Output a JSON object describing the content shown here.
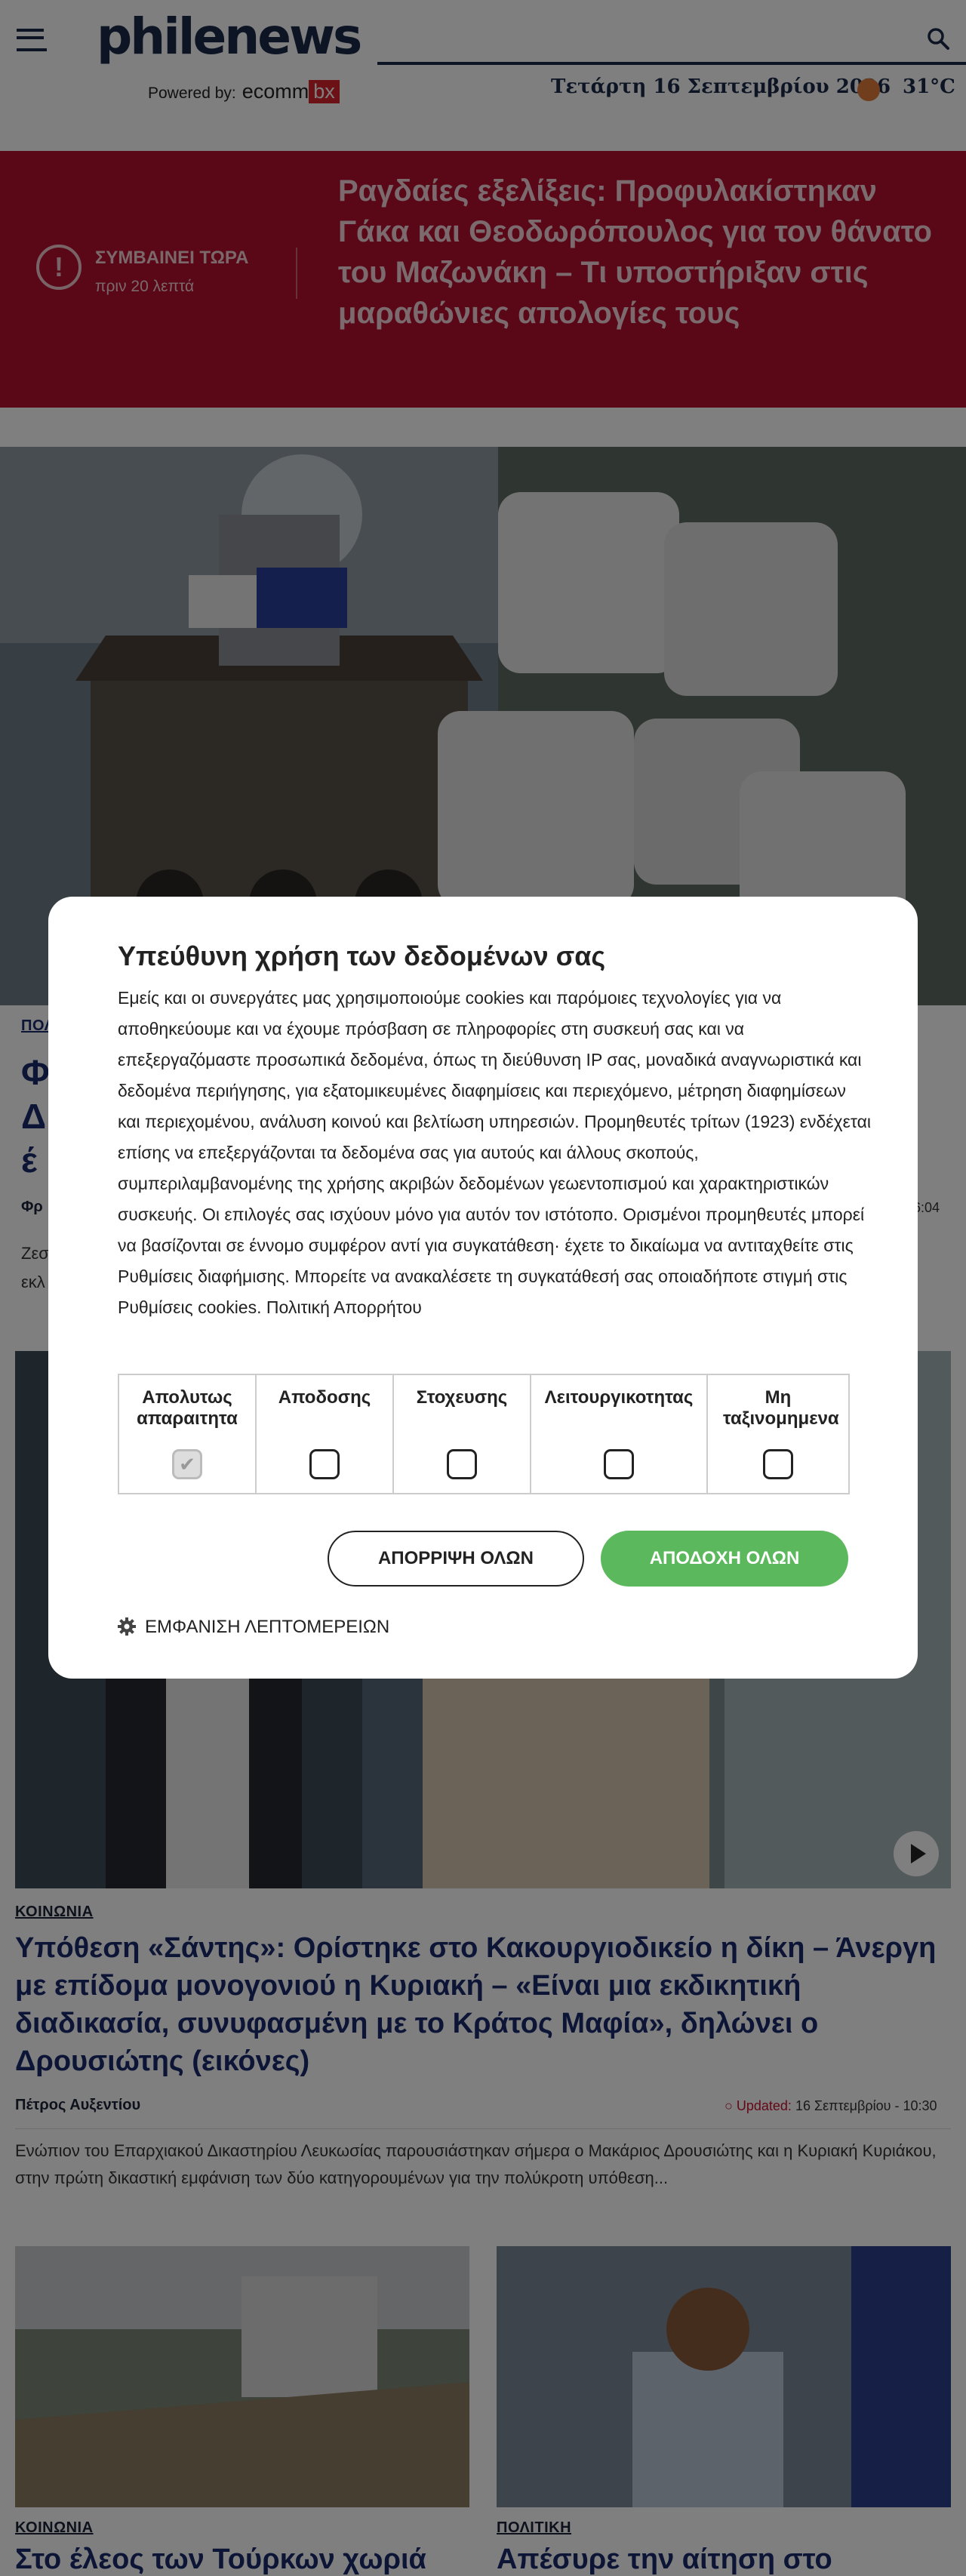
{
  "header": {
    "logo": "philenews",
    "powered_by": "Powered by:",
    "powered_brand_a": "ecomm",
    "powered_brand_b": "bx",
    "date": "Τετάρτη 16 Σεπτεμβρίου 2026",
    "temperature": "31°C"
  },
  "breaking": {
    "label": "ΣΥΜΒΑΙΝΕΙ ΤΩΡΑ",
    "time": "πριν 20 λεπτά",
    "title": "Ραγδαίες εξελίξεις: Προφυλακίστηκαν Γάκα και Θεοδωρόπουλος για τον θάνατο του Μαζωνάκη – Τι υποστήριξαν στις μαραθώνιες απολογίες τους"
  },
  "lead": {
    "cat_fragment": "ΠΟΛ",
    "title_fragments": [
      "Φ",
      "Δ",
      "έ"
    ],
    "author_fragment": "Φρ",
    "time_fragment": "6:04",
    "summary_fragments": [
      "Ζεσ",
      "εκλ"
    ]
  },
  "article2": {
    "category": "ΚΟΙΝΩΝΙΑ",
    "title": "Υπόθεση «Σάντης»: Ορίστηκε στο Κακουργιοδικείο η δίκη – Άνεργη με επίδομα μονογονιού η Κυριακή – «Είναι μια εκδικητική διαδικασία, συνυφασμένη με το Κράτος Μαφία», δηλώνει ο Δρουσιώτης (εικόνες)",
    "author": "Πέτρος Αυξεντίου",
    "updated_label": "Updated:",
    "updated_value": "16 Σεπτεμβρίου - 10:30",
    "summary": "Ενώπιον του Επαρχιακού Δικαστηρίου Λευκωσίας παρουσιάστηκαν σήμερα ο Μακάριος Δρουσιώτης και η Κυριακή Κυριάκου, στην πρώτη δικαστική εμφάνιση των δύο κατηγορουμένων για την πολύκροτη υπόθεση..."
  },
  "cards": [
    {
      "category": "ΚΟΙΝΩΝΙΑ",
      "title": "Στο έλεος των Τούρκων χωριά"
    },
    {
      "category": "ΠΟΛΙΤΙΚΗ",
      "title": "Απέσυρε την αίτηση στο"
    }
  ],
  "consent": {
    "title": "Υπεύθυνη χρήση των δεδομένων σας",
    "body": "Εμείς και οι συνεργάτες μας χρησιμοποιούμε cookies και παρόμοιες τεχνολογίες για να αποθηκεύουμε και να έχουμε πρόσβαση σε πληροφορίες στη συσκευή σας και να επεξεργαζόμαστε προσωπικά δεδομένα, όπως τη διεύθυνση IP σας, μοναδικά αναγνωριστικά και δεδομένα περιήγησης, για εξατομικευμένες διαφημίσεις και περιεχόμενο, μέτρηση διαφημίσεων και περιεχομένου, ανάλυση κοινού και βελτίωση υπηρεσιών. Προμηθευτές τρίτων (1923) ενδέχεται επίσης να επεξεργάζονται τα δεδομένα σας για αυτούς και άλλους σκοπούς, συμπεριλαμβανομένης της χρήσης ακριβών δεδομένων γεωεντοπισμού και χαρακτηριστικών συσκευής. Οι επιλογές σας ισχύουν μόνο για αυτόν τον ιστότοπο. Ορισμένοι προμηθευτές μπορεί να βασίζονται σε έννομο συμφέρον αντί για συγκατάθεση· έχετε το δικαίωμα να αντιταχθείτε στις Ρυθμίσεις διαφήμισης. Μπορείτε να ανακαλέσετε τη συγκατάθεσή σας οποιαδήποτε στιγμή στις Ρυθμίσεις cookies. Πολιτική Απορρήτου",
    "categories": [
      {
        "label": "Απολυτως απαραιτητα",
        "checked": true
      },
      {
        "label": "Αποδοσης",
        "checked": false
      },
      {
        "label": "Στοχευσης",
        "checked": false
      },
      {
        "label": "Λειτουργικοτητας",
        "checked": false
      },
      {
        "label": "Μη ταξινομημενα",
        "checked": false
      }
    ],
    "reject_label": "ΑΠΟΡΡΙΨΗ ΟΛΩΝ",
    "accept_label": "ΑΠΟΔΟΧΗ ΟΛΩΝ",
    "details_label": "ΕΜΦΑΝΙΣΗ ΛΕΠΤΟΜΕΡΕΙΩΝ"
  }
}
